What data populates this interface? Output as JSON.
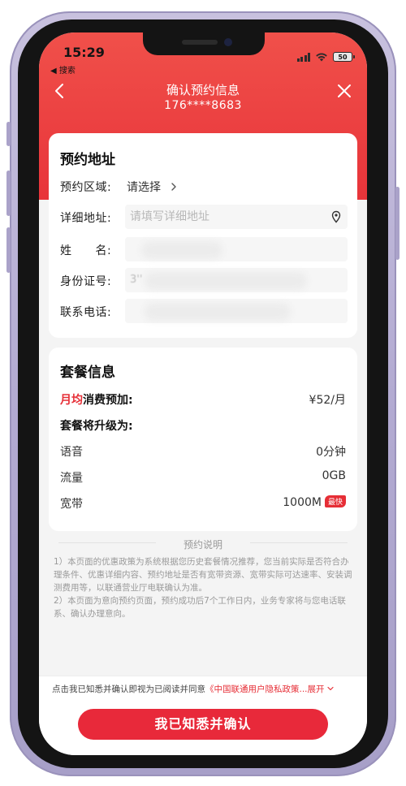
{
  "status_bar": {
    "time": "15:29",
    "back_app": "◀ 搜索",
    "battery": "50"
  },
  "nav": {
    "title": "确认预约信息",
    "phone": "176****8683"
  },
  "address_card": {
    "title": "预约地址",
    "region_label": "预约区域:",
    "region_value": "请选择",
    "detail_label": "详细地址:",
    "detail_placeholder": "请填写详细地址",
    "name_label": "姓　　名:",
    "id_label": "身份证号:",
    "id_value": "3''",
    "phone_label": "联系电话:"
  },
  "package_card": {
    "title": "套餐信息",
    "monthly_red": "月均",
    "monthly_label": "消费预加:",
    "monthly_value": "¥52/月",
    "upgrade_label": "套餐将升级为:",
    "rows": [
      {
        "label": "语音",
        "value": "0分钟"
      },
      {
        "label": "流量",
        "value": "0GB"
      },
      {
        "label": "宽带",
        "value": "1000M",
        "badge": "最快"
      }
    ]
  },
  "notice": {
    "title": "预约说明",
    "line1": "1）本页面的优惠政策为系统根据您历史套餐情况推荐，您当前实际是否符合办理条件、优惠详细内容、预约地址是否有宽带资源、宽带实际可达速率、安装调测费用等，以联通营业厅电联确认为准。",
    "line2": "2）本页面为意向预约页面，预约成功后7个工作日内，业务专家将与您电话联系、确认办理意向。"
  },
  "footer": {
    "agree_prefix": "点击我已知悉并确认即视为已阅读并同意",
    "policy_text": "《中国联通用户隐私政策...",
    "expand_text": "展开",
    "confirm_label": "我已知悉并确认"
  },
  "colors": {
    "brand_red": "#e8293a",
    "header_red": "#f0504a"
  }
}
